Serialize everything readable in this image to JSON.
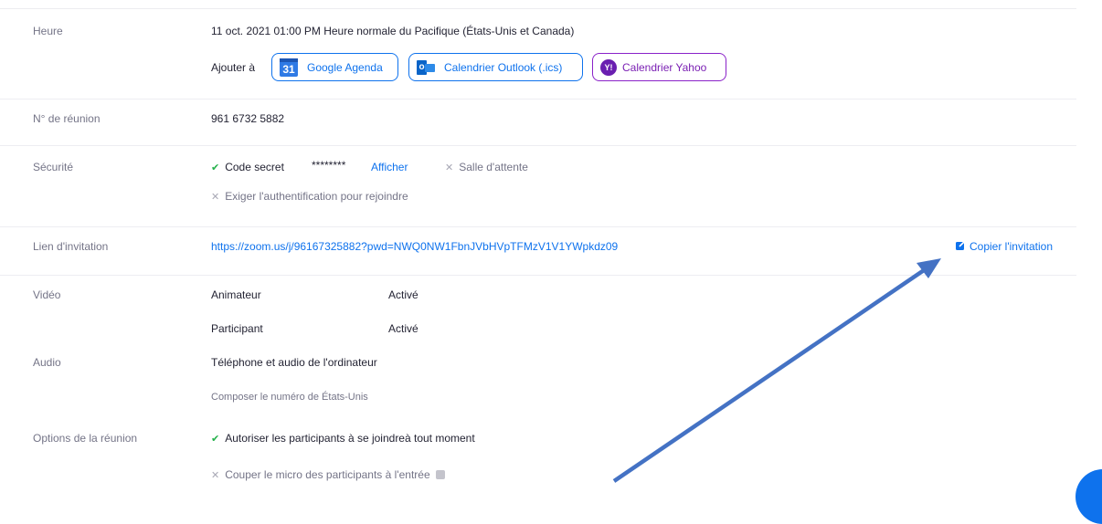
{
  "heure": {
    "label": "Heure",
    "datetime": "11 oct. 2021 01:00 PM Heure normale du Pacifique (États-Unis et Canada)",
    "add_to": "Ajouter à",
    "google": "Google Agenda",
    "google_icon_text": "31",
    "outlook": "Calendrier Outlook (.ics)",
    "outlook_icon_text": "o",
    "yahoo": "Calendrier Yahoo",
    "yahoo_icon_text": "Y!"
  },
  "meeting_id": {
    "label": "N° de réunion",
    "value": "961 6732 5882"
  },
  "security": {
    "label": "Sécurité",
    "passcode_label": "Code secret",
    "passcode_mask": "********",
    "show_link": "Afficher",
    "waiting_room": "Salle d'attente",
    "require_auth": "Exiger l'authentification pour rejoindre"
  },
  "invite": {
    "label": "Lien d'invitation",
    "url": "https://zoom.us/j/96167325882?pwd=NWQ0NW1FbnJVbHVpTFMzV1V1YWpkdz09",
    "copy": "Copier l'invitation"
  },
  "video": {
    "label": "Vidéo",
    "host": "Animateur",
    "host_state": "Activé",
    "participant": "Participant",
    "participant_state": "Activé"
  },
  "audio": {
    "label": "Audio",
    "value": "Téléphone et audio de l'ordinateur",
    "dial": "Composer le numéro de États-Unis"
  },
  "options": {
    "label": "Options de la réunion",
    "join_anytime": "Autoriser les participants à se joindreà tout moment",
    "mute_on_entry": "Couper le micro des participants à l'entrée"
  },
  "colors": {
    "accent": "#0e72ed",
    "arrow": "#4472c4",
    "yahoo": "#7a1fb3",
    "check": "#23b14a"
  }
}
